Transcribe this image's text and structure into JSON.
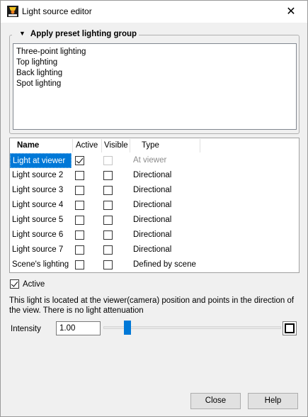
{
  "window": {
    "title": "Light source editor",
    "close_glyph": "✕"
  },
  "preset": {
    "legend": "Apply preset lighting group",
    "collapse_glyph": "▼",
    "items": [
      "Three-point lighting",
      "Top lighting",
      "Back lighting",
      "Spot lighting"
    ]
  },
  "table": {
    "headers": {
      "name": "Name",
      "active": "Active",
      "visible": "Visible",
      "type": "Type"
    },
    "rows": [
      {
        "name": "Light at viewer",
        "active": true,
        "visible": false,
        "visible_disabled": true,
        "type": "At viewer",
        "type_disabled": true,
        "selected": true
      },
      {
        "name": "Light source 2",
        "active": false,
        "visible": false,
        "visible_disabled": false,
        "type": "Directional",
        "type_disabled": false,
        "selected": false
      },
      {
        "name": "Light source 3",
        "active": false,
        "visible": false,
        "visible_disabled": false,
        "type": "Directional",
        "type_disabled": false,
        "selected": false
      },
      {
        "name": "Light source 4",
        "active": false,
        "visible": false,
        "visible_disabled": false,
        "type": "Directional",
        "type_disabled": false,
        "selected": false
      },
      {
        "name": "Light source 5",
        "active": false,
        "visible": false,
        "visible_disabled": false,
        "type": "Directional",
        "type_disabled": false,
        "selected": false
      },
      {
        "name": "Light source 6",
        "active": false,
        "visible": false,
        "visible_disabled": false,
        "type": "Directional",
        "type_disabled": false,
        "selected": false
      },
      {
        "name": "Light source 7",
        "active": false,
        "visible": false,
        "visible_disabled": false,
        "type": "Directional",
        "type_disabled": false,
        "selected": false
      },
      {
        "name": "Scene's lighting",
        "active": false,
        "visible": false,
        "visible_disabled": false,
        "type": "Defined by scene",
        "type_disabled": false,
        "selected": false
      }
    ]
  },
  "active_toggle": {
    "label": "Active",
    "checked": true
  },
  "description": "This light is located at the viewer(camera) position and points in the direction of the view.  There is no light attenuation",
  "intensity": {
    "label": "Intensity",
    "value": "1.00",
    "slider_fraction": 0.12
  },
  "buttons": {
    "close": "Close",
    "help": "Help"
  },
  "colors": {
    "accent": "#0078d7",
    "background": "#f0f0f0"
  },
  "icons": {
    "app": "app-logo-icon",
    "close": "close-icon",
    "collapse": "triangle-down-icon",
    "color": "color-swatch-icon"
  }
}
